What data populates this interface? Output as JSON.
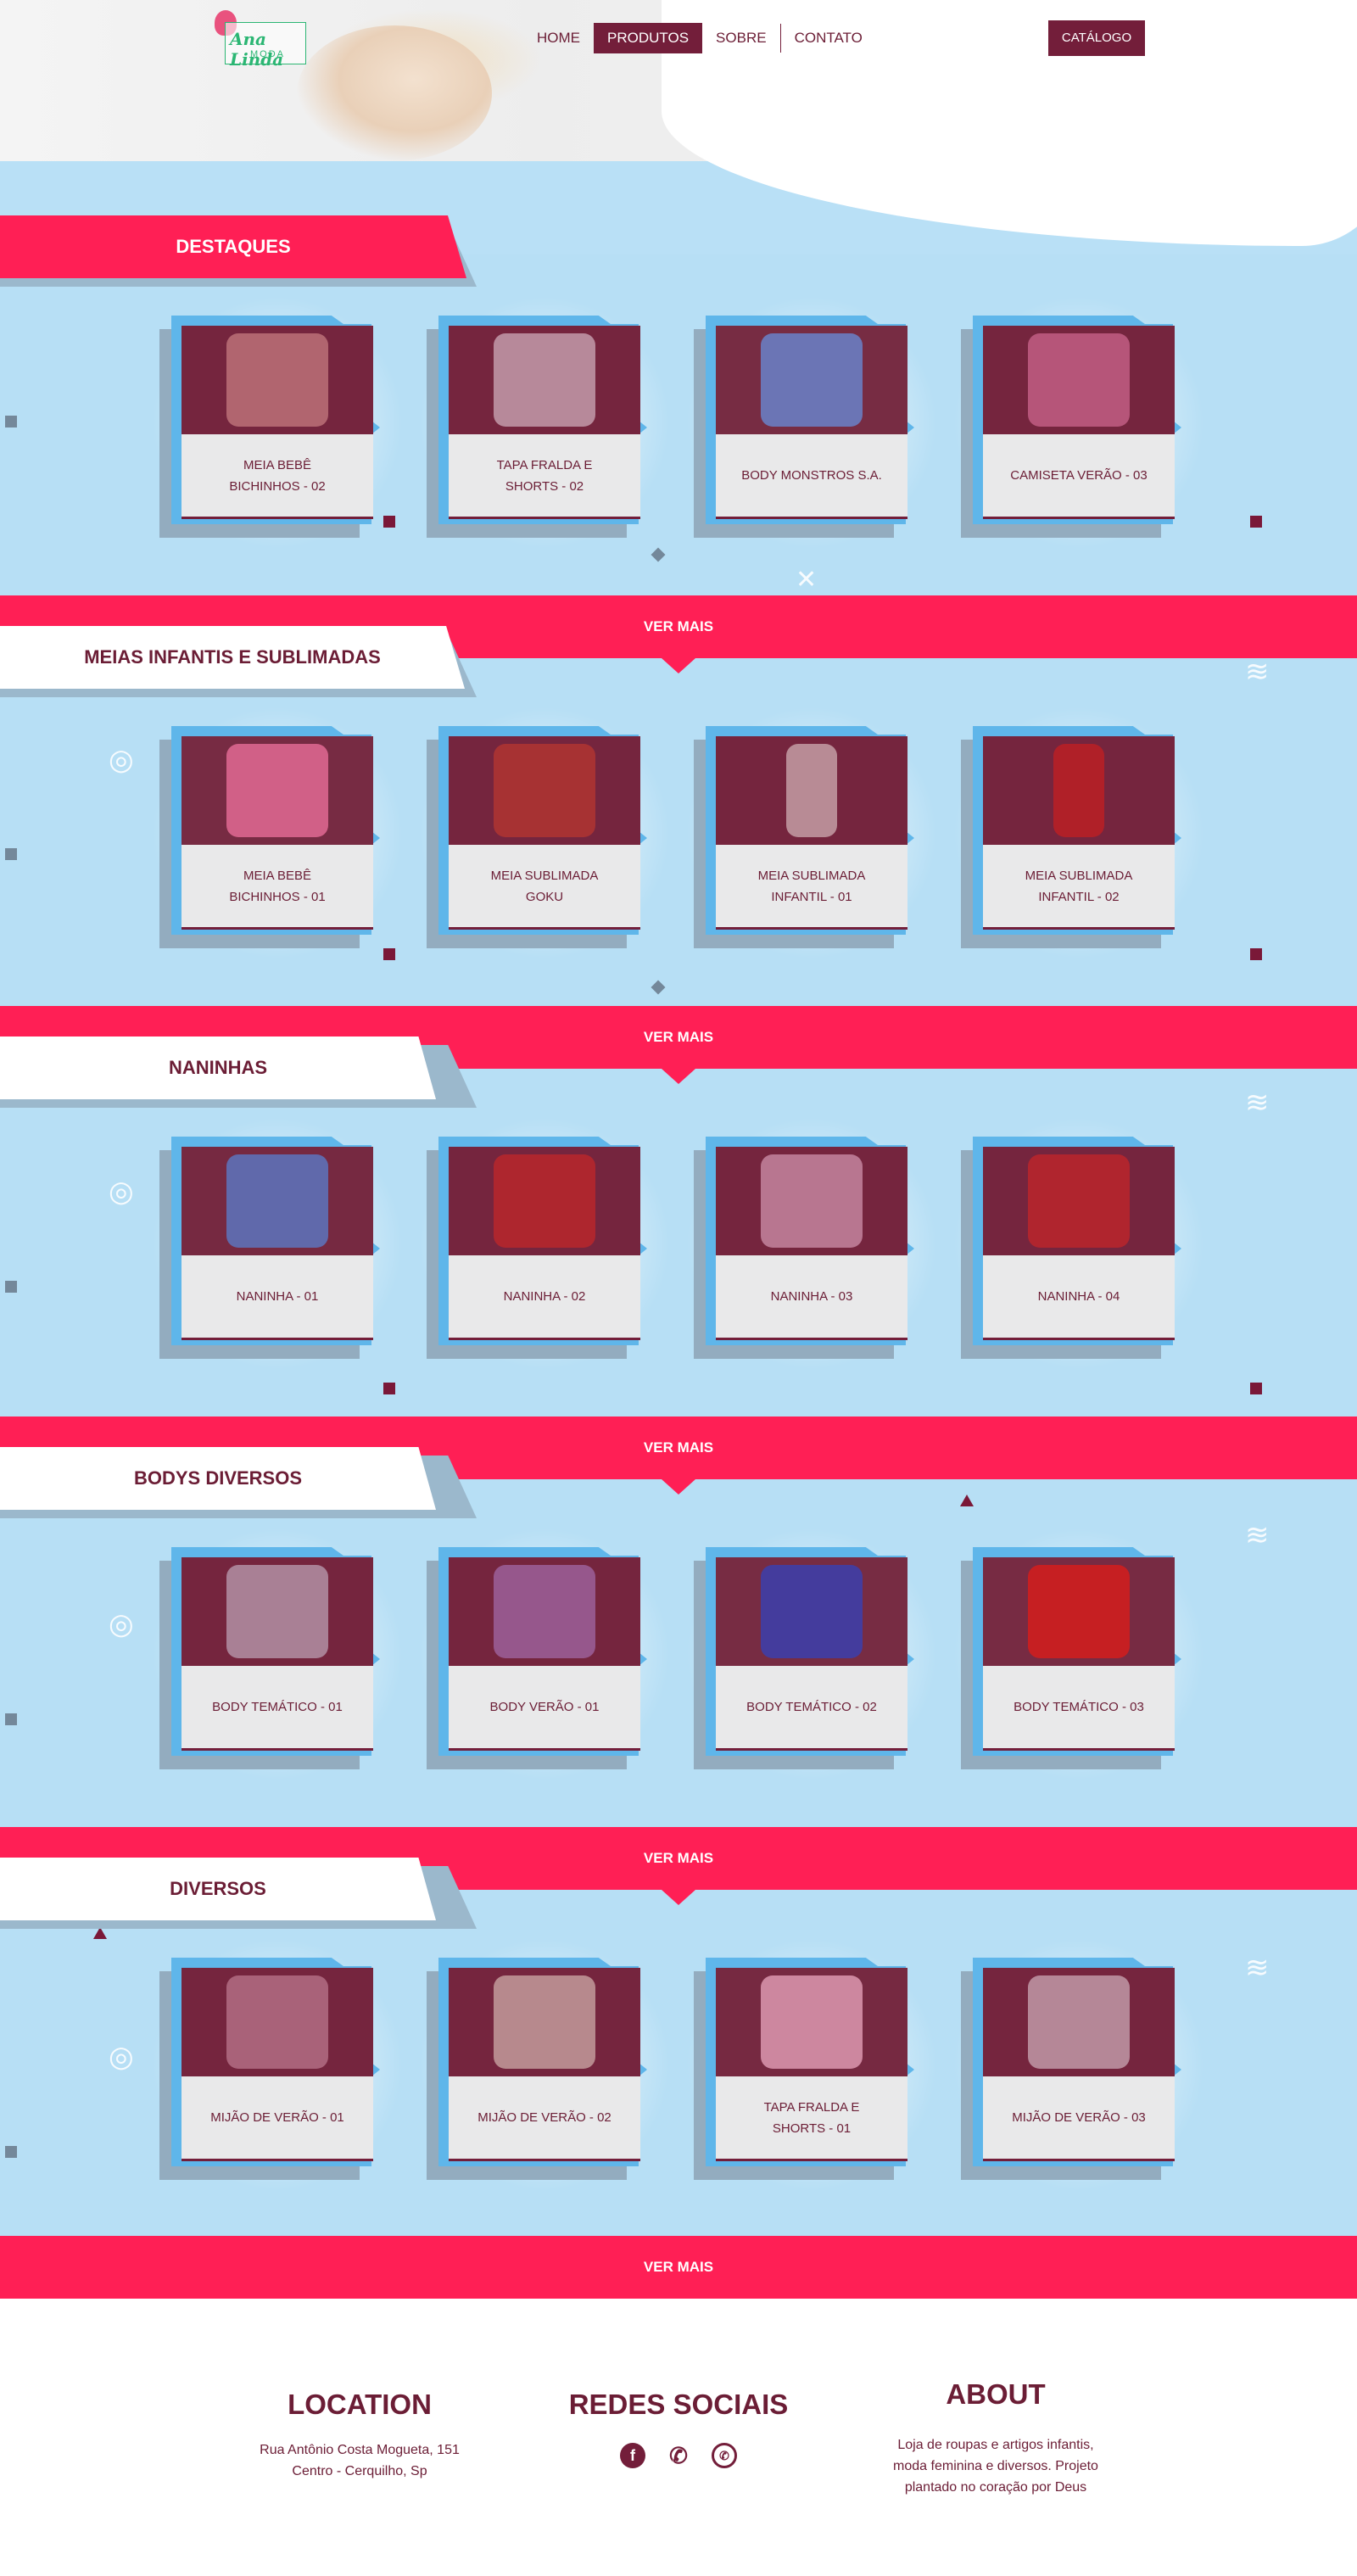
{
  "header": {
    "logo": {
      "name": "Ana Linda",
      "sub": "MODA"
    },
    "nav": [
      {
        "label": "Home"
      },
      {
        "label": "Produtos"
      },
      {
        "label": "Sobre"
      },
      {
        "label": "Contato"
      }
    ],
    "catalog_label": "Catálogo"
  },
  "sections": [
    {
      "title": "DESTAQUES",
      "items": [
        "Meia bebê bichinhos - 02",
        "Tapa fralda e shorts - 02",
        "Body Monstros S.A.",
        "Camiseta verão - 03"
      ]
    },
    {
      "title": "MEIAS INFANTIS E SUBLIMADAS",
      "items": [
        "Meia bebê bichinhos - 01",
        "Meia Sublimada Goku",
        "Meia Sublimada infantil - 01",
        "Meia Sublimada infantil - 02"
      ]
    },
    {
      "title": "NANINHAS",
      "items": [
        "Naninha - 01",
        "Naninha - 02",
        "Naninha - 03",
        "Naninha - 04"
      ]
    },
    {
      "title": "BODYS DIVERSOS",
      "items": [
        "Body temático - 01",
        "Body verão - 01",
        "Body temático - 02",
        "Body temático - 03"
      ]
    },
    {
      "title": "DIVERSOS",
      "items": [
        "Mijão de verão - 01",
        "Mijão de verão - 02",
        "Tapa fralda e shorts - 01",
        "Mijão de verão - 03"
      ]
    }
  ],
  "ver_mais_label": "Ver mais",
  "footer": {
    "location": {
      "title": "LOCATION",
      "line1": "Rua Antônio Costa Mogueta, 151",
      "line2": "Centro - Cerquilho, Sp"
    },
    "social": {
      "title": "REDES SOCIAIS",
      "icons": [
        "facebook-icon",
        "phone-icon",
        "whatsapp-icon"
      ]
    },
    "about": {
      "title": "ABOUT",
      "line1": "Loja de roupas e artigos infantis,",
      "line2": "moda feminina e diversos. Projeto",
      "line3": "plantado no coração por Deus"
    }
  },
  "colors": {
    "accent": "#ff1f55",
    "brand": "#731e3a",
    "background": "#b7dff5"
  }
}
